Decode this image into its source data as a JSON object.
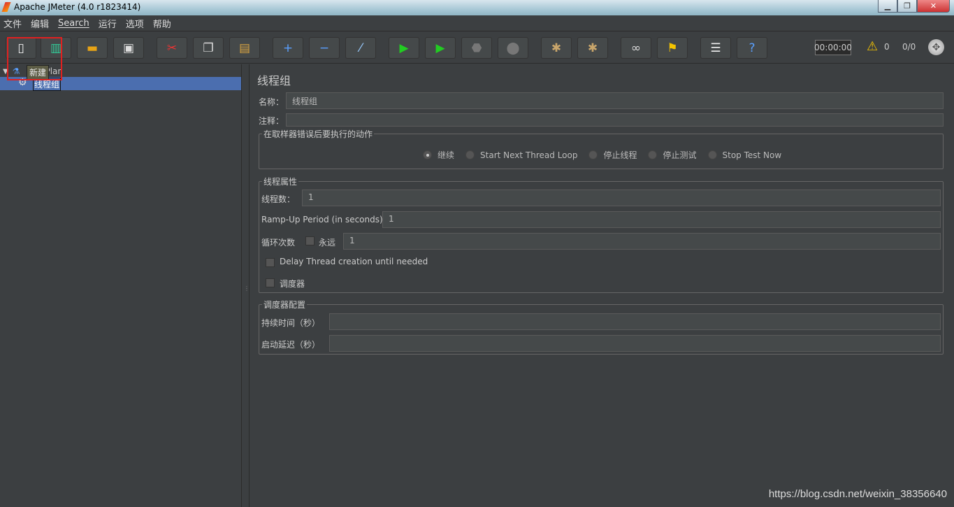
{
  "window": {
    "title": "Apache JMeter (4.0 r1823414)"
  },
  "menu": [
    "文件",
    "编辑",
    "Search",
    "运行",
    "选项",
    "帮助"
  ],
  "toolbar": {
    "buttons": [
      "new",
      "templates",
      "open",
      "save",
      "cut",
      "copy",
      "paste",
      "expand-all",
      "collapse-all",
      "toggle",
      "start",
      "start-no-pauses",
      "stop",
      "shutdown",
      "clear",
      "clear-all",
      "search",
      "reset-search",
      "function-helper",
      "help"
    ],
    "timer": "00:00:00",
    "warnings": "0",
    "threads": "0/0",
    "tooltip": "新建"
  },
  "tree": {
    "root": "Test Plan",
    "root_visible": "Plan",
    "child": "线程组"
  },
  "panel": {
    "title": "线程组",
    "name_label": "名称：",
    "name_value": "线程组",
    "comment_label": "注释：",
    "comment_value": "",
    "error_group": "在取样器错误后要执行的动作",
    "error_options": [
      "继续",
      "Start Next Thread Loop",
      "停止线程",
      "停止测试",
      "Stop Test Now"
    ],
    "error_selected": "继续",
    "thread_group": "线程属性",
    "threads_label": "线程数：",
    "threads_value": "1",
    "rampup_label": "Ramp-Up Period (in seconds):",
    "rampup_value": "1",
    "loop_label": "循环次数",
    "forever_label": "永远",
    "forever_checked": false,
    "loop_value": "1",
    "delay_label": "Delay Thread creation until needed",
    "delay_checked": false,
    "scheduler_label": "调度器",
    "scheduler_checked": false,
    "scheduler_group": "调度器配置",
    "duration_label": "持续时间（秒）",
    "duration_value": "",
    "startup_label": "启动延迟（秒）",
    "startup_value": ""
  },
  "watermark": "https://blog.csdn.net/weixin_38356640"
}
